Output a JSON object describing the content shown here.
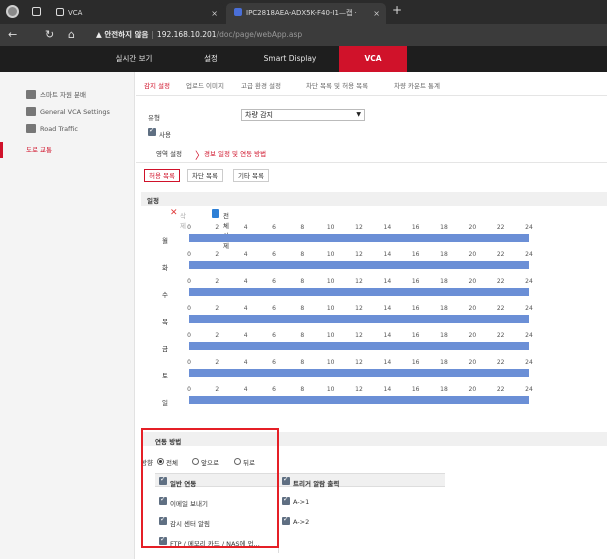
{
  "browser": {
    "tabs": [
      {
        "title": "VCA",
        "close": "×"
      },
      {
        "title": "IPC2818AEA-ADX5K-F40-I1—캡ㆍ",
        "close": "×"
      }
    ],
    "new_tab": "+",
    "address": {
      "warning": "▲ 안전하지 않음",
      "separator": "|",
      "host": "192.168.10.201",
      "path": "/doc/page/webApp.asp"
    },
    "nav_icons": [
      "back-icon",
      "refresh-icon",
      "home-icon"
    ]
  },
  "app_nav": {
    "items": [
      {
        "label": "실시간 보기"
      },
      {
        "label": "설정"
      },
      {
        "label": "Smart Display"
      },
      {
        "label": "VCA",
        "active": true
      }
    ]
  },
  "sidebar": {
    "items": [
      {
        "label": "스마트 자원 분배"
      },
      {
        "label": "General VCA Settings"
      },
      {
        "label": "Road Traffic"
      },
      {
        "label": "도로 교통",
        "active": true
      }
    ]
  },
  "subtabs": [
    {
      "label": "감지 설정",
      "active": true
    },
    {
      "label": "업로드 이미지"
    },
    {
      "label": "고급 환경 설정"
    },
    {
      "label": "차단 목록 및 허용 목록"
    },
    {
      "label": "차량 카운트 통계"
    }
  ],
  "form": {
    "type_label": "유형",
    "type_value": "차량 감지",
    "enable_label": "사용"
  },
  "steps": {
    "area": "영역 설정",
    "arrow": "〉",
    "schedule": "경보 일정 및 연동 방법"
  },
  "list_tabs": [
    {
      "label": "허용 목록",
      "active": true
    },
    {
      "label": "차단 목록"
    },
    {
      "label": "기타 목록"
    }
  ],
  "schedule": {
    "title": "일정",
    "delete_label": "삭제",
    "delete_all_label": "전체 삭제",
    "hours": [
      "0",
      "2",
      "4",
      "6",
      "8",
      "10",
      "12",
      "14",
      "16",
      "18",
      "20",
      "22",
      "24"
    ],
    "days": [
      "월",
      "화",
      "수",
      "목",
      "금",
      "토",
      "일"
    ],
    "coverage": [
      [
        0,
        24
      ],
      [
        0,
        24
      ],
      [
        0,
        24
      ],
      [
        0,
        24
      ],
      [
        0,
        24
      ],
      [
        0,
        24
      ],
      [
        0,
        24
      ]
    ]
  },
  "linkage": {
    "title": "연동 방법",
    "direction_label": "방향",
    "direction_options": [
      {
        "label": "전체",
        "selected": true
      },
      {
        "label": "앞으로",
        "selected": false
      },
      {
        "label": "뒤로",
        "selected": false
      }
    ],
    "normal_header": "일반 연동",
    "normal_items": [
      "이메일 보내기",
      "감시 센터 알림",
      "FTP / 메모리 카드 / NAS에 업..."
    ],
    "trigger_header": "트리거 알람 출력",
    "trigger_items": [
      "A->1",
      "A->2"
    ]
  },
  "colors": {
    "accent": "#d0122a",
    "schedule_bar": "#6b8fd6",
    "highlight_box": "#e51f26"
  }
}
